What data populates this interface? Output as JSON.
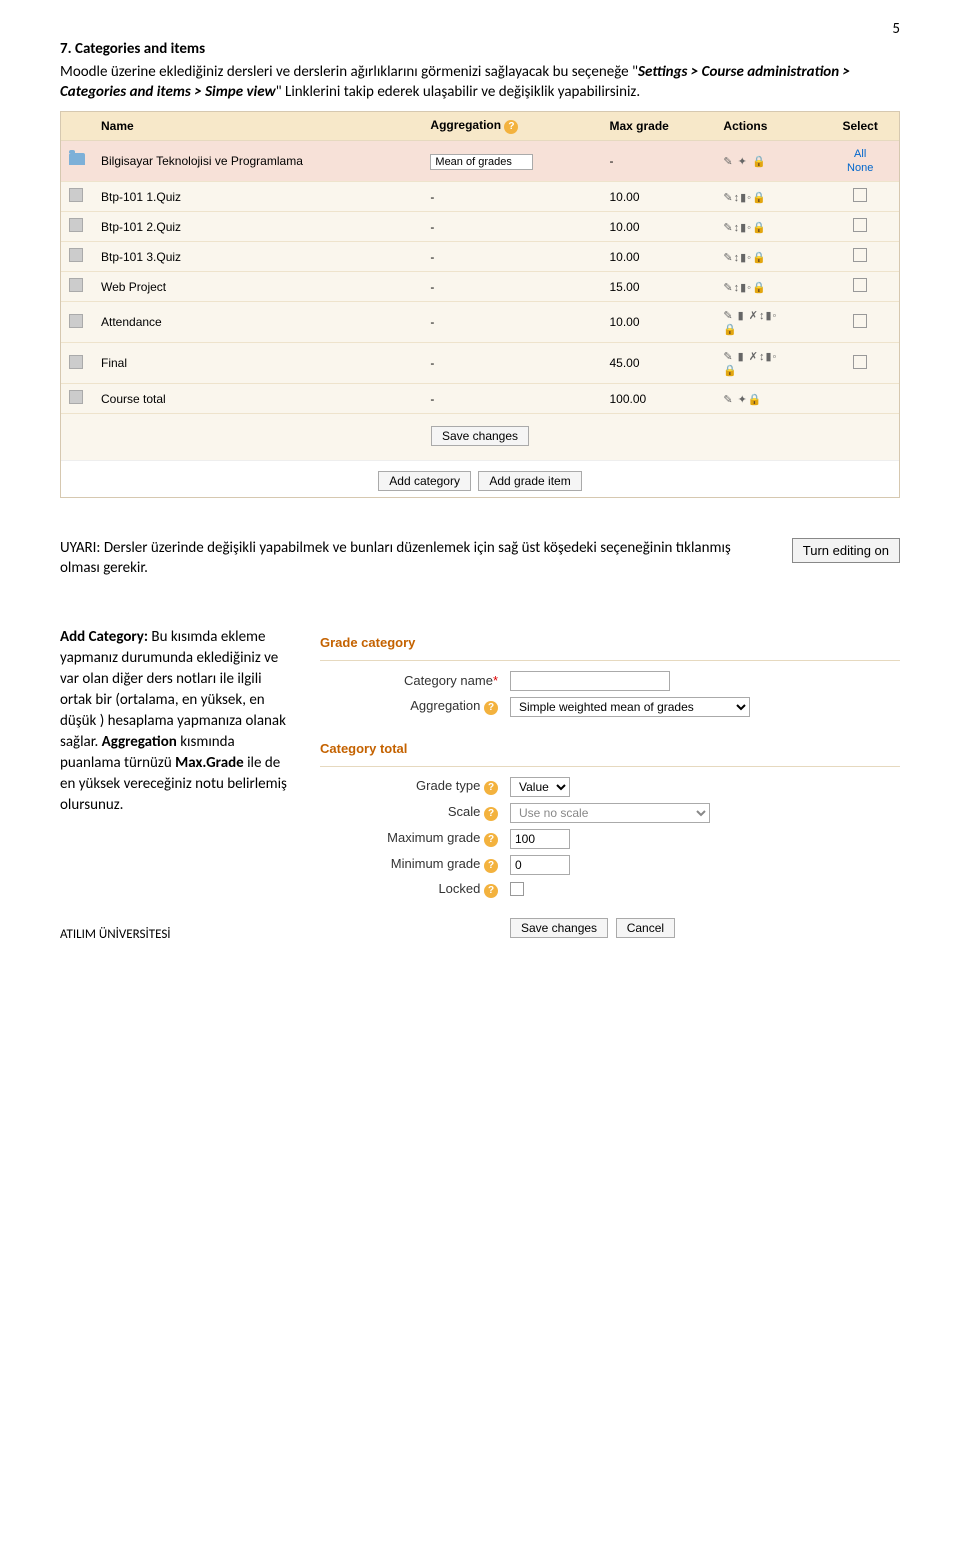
{
  "pageNumber": "5",
  "section": {
    "heading": "7. Categories and items",
    "para1a": "Moodle üzerine eklediğiniz dersleri ve derslerin ağırlıklarını görmenizi sağlayacak bu seçeneğe \"",
    "para1_path": "Settings > Course administration > Categories and items > Simpe view",
    "para1b": "\" Linklerini takip ederek ulaşabilir ve değişiklik yapabilirsiniz.",
    "warning": "UYARI: Dersler üzerinde değişikli yapabilmek ve bunları düzenlemek için sağ üst köşedeki seçeneğinin tıklanmış olması gerekir.",
    "addcat_label": "Add Category:",
    "addcat_body": " Bu kısımda ekleme yapmanız durumunda eklediğiniz ve var olan diğer ders notları ile ilgili ortak bir (ortalama, en yüksek, en düşük ) hesaplama yapmanıza olanak sağlar. ",
    "addcat_b2": "Aggregation",
    "addcat_c": " kısmında puanlama türnüzü ",
    "addcat_b3": "Max.Grade",
    "addcat_d": " ile de en yüksek vereceğiniz notu belirlemiş olursunuz."
  },
  "shot1": {
    "headers": {
      "name": "Name",
      "agg": "Aggregation",
      "max": "Max grade",
      "act": "Actions",
      "sel": "Select"
    },
    "catRow": {
      "name": "Bilgisayar Teknolojisi ve Programlama",
      "agg": "Mean of grades",
      "max": "-",
      "all": "All",
      "none": "None"
    },
    "rows": [
      {
        "name": "Btp-101 1.Quiz",
        "max": "10.00"
      },
      {
        "name": "Btp-101 2.Quiz",
        "max": "10.00"
      },
      {
        "name": "Btp-101 3.Quiz",
        "max": "10.00"
      },
      {
        "name": "Web Project",
        "max": "15.00"
      },
      {
        "name": "Attendance",
        "max": "10.00"
      },
      {
        "name": "Final",
        "max": "45.00"
      },
      {
        "name": "Course total",
        "max": "100.00"
      }
    ],
    "save": "Save changes",
    "addCat": "Add category",
    "addItem": "Add grade item"
  },
  "turnEditingOn": "Turn editing on",
  "shot2": {
    "sec1": "Grade category",
    "labCatName": "Category name",
    "labAgg": "Aggregation",
    "aggValue": "Simple weighted mean of grades",
    "sec2": "Category total",
    "labGradeType": "Grade type",
    "gradeTypeVal": "Value",
    "labScale": "Scale",
    "scaleVal": "Use no scale",
    "labMax": "Maximum grade",
    "maxVal": "100",
    "labMin": "Minimum grade",
    "minVal": "0",
    "labLocked": "Locked",
    "btnSave": "Save changes",
    "btnCancel": "Cancel"
  },
  "footer": "ATILIM ÜNİVERSİTESİ"
}
